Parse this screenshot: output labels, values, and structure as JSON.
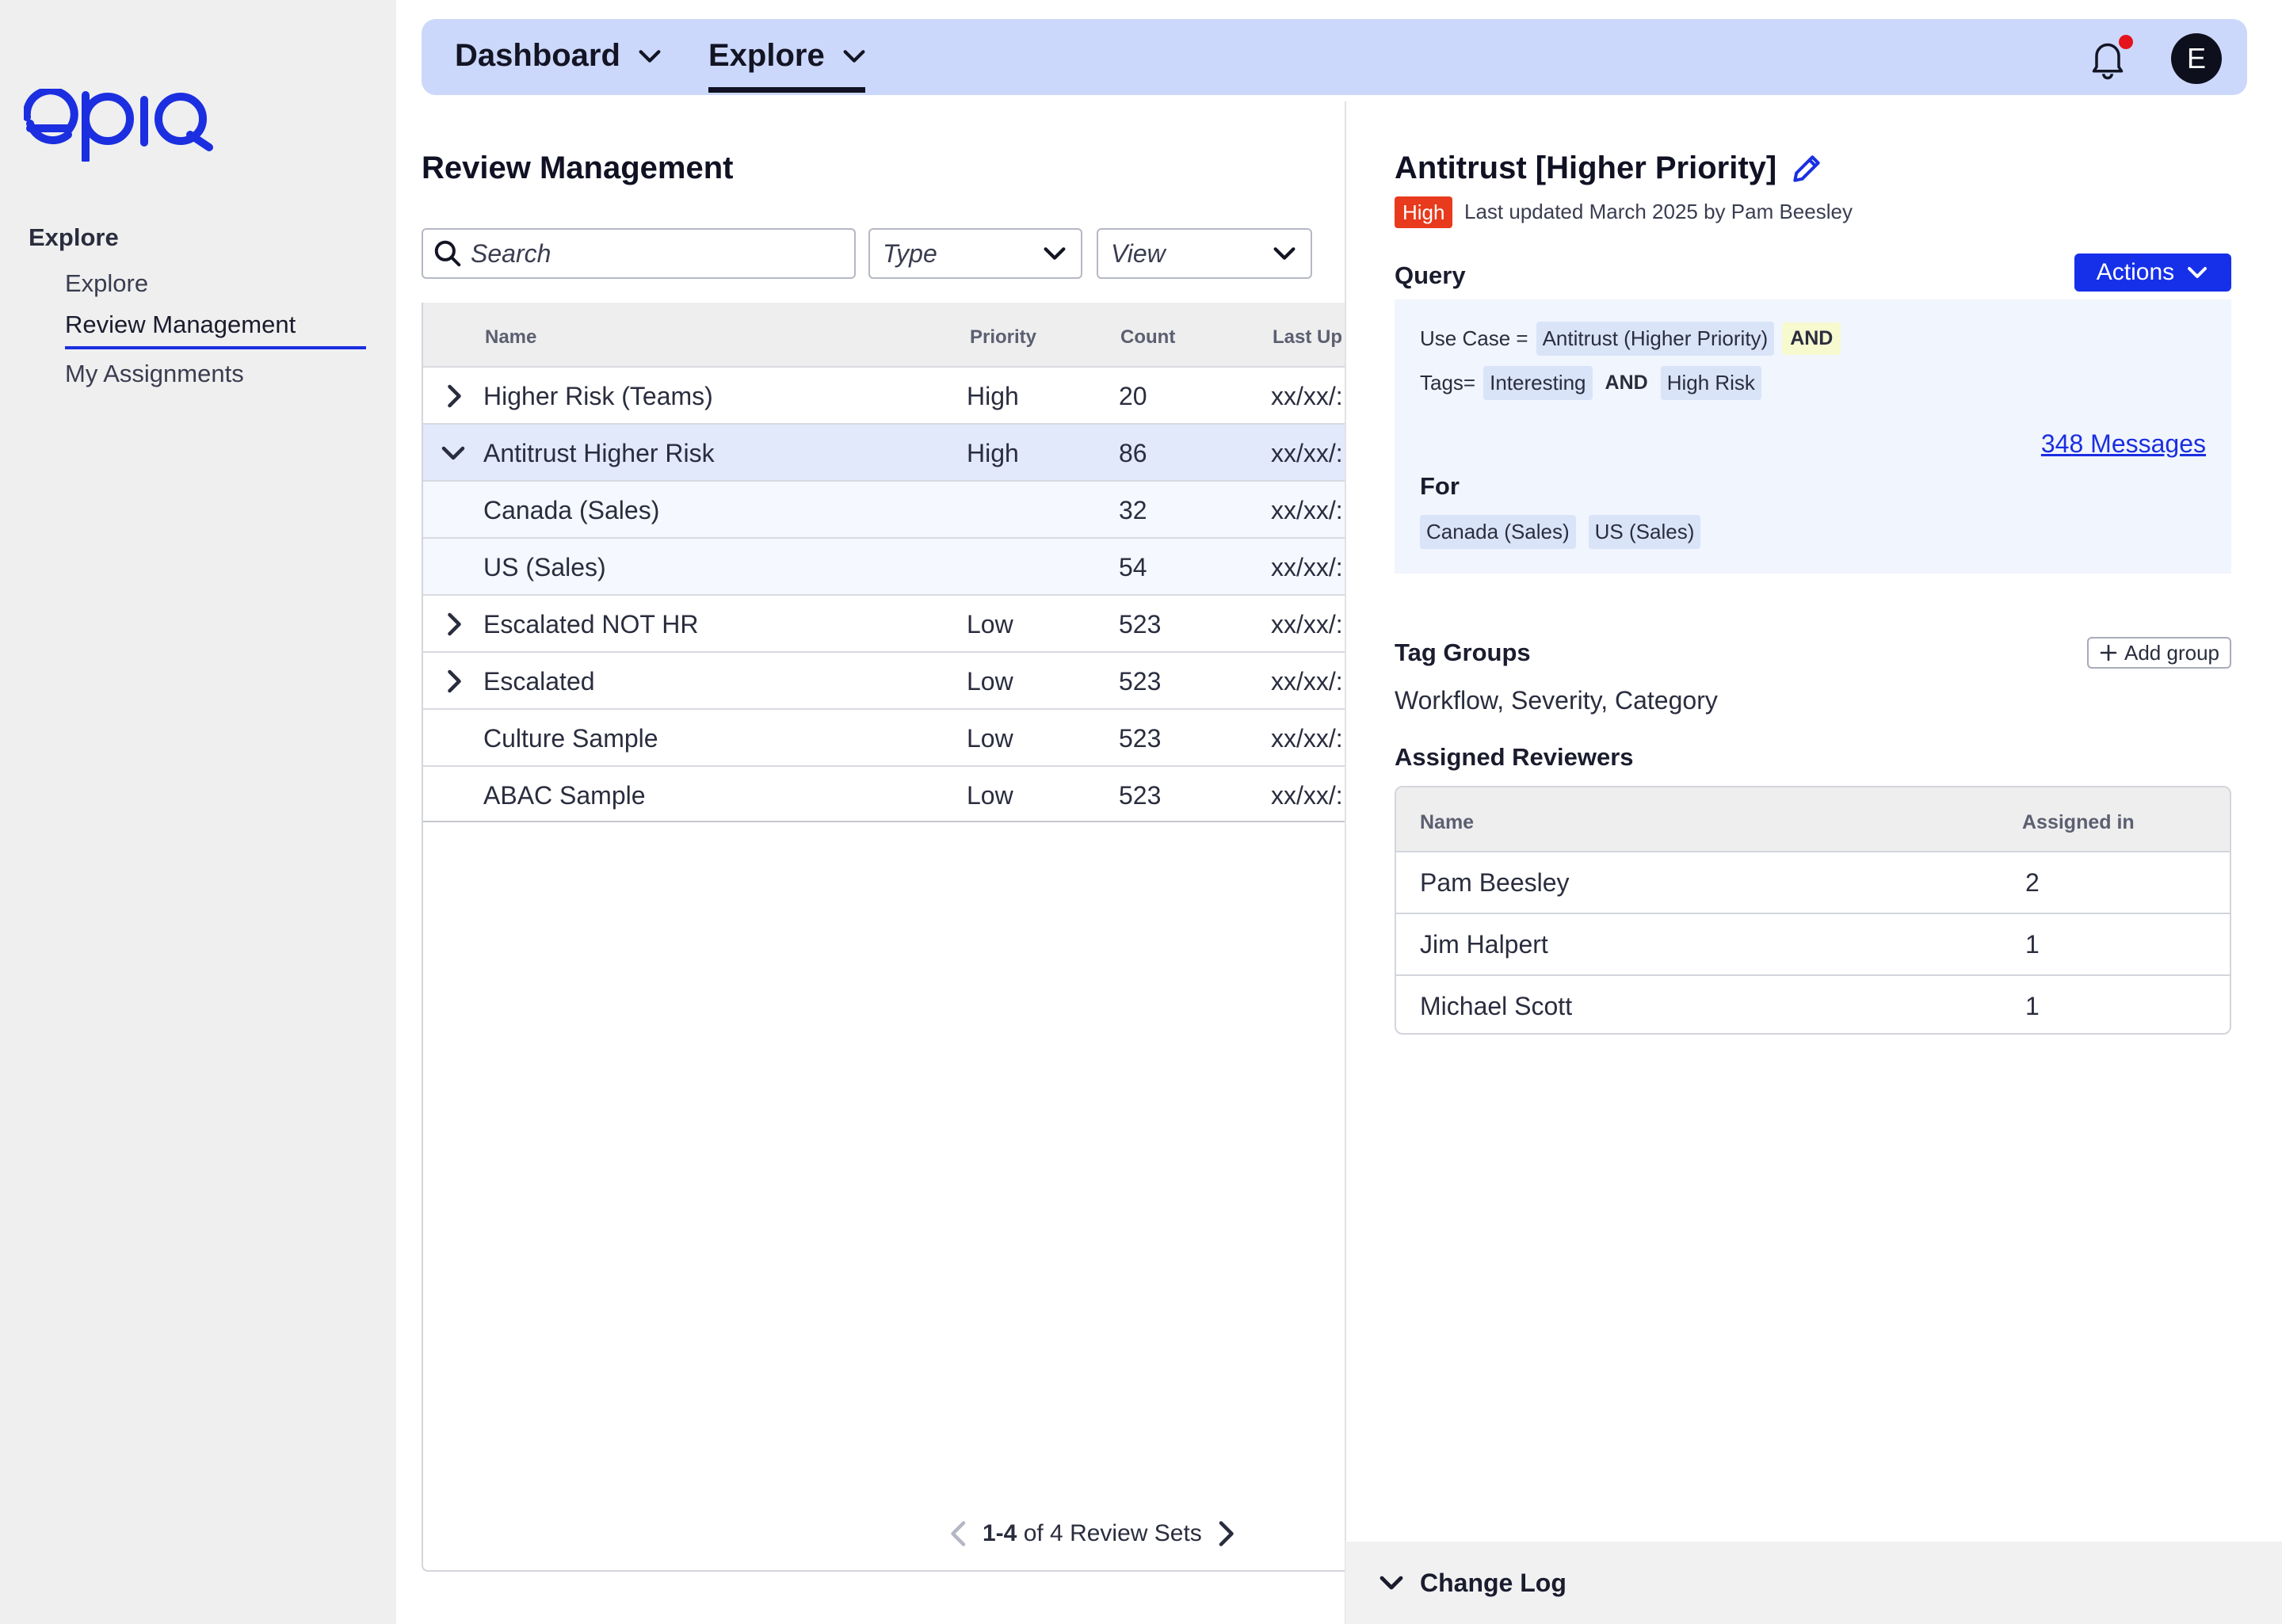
{
  "brand": {
    "logo_text": "epiq",
    "accent": "#1b2fe0"
  },
  "sidebar": {
    "section": "Explore",
    "items": [
      {
        "label": "Explore"
      },
      {
        "label": "Review Management"
      },
      {
        "label": "My Assignments"
      }
    ],
    "active_index": 1
  },
  "topbar": {
    "tabs": [
      {
        "label": "Dashboard"
      },
      {
        "label": "Explore"
      }
    ],
    "active_tab": "Explore",
    "notifications_icon": "bell-icon",
    "has_unread": true,
    "avatar_initial": "E"
  },
  "review": {
    "title": "Review Management",
    "search_placeholder": "Search",
    "filters": {
      "type": "Type",
      "view": "View"
    },
    "columns": [
      "Name",
      "Priority",
      "Count",
      "Last Up"
    ],
    "rows": [
      {
        "name": "Higher Risk (Teams)",
        "priority": "High",
        "count": "20",
        "last": "xx/xx/:",
        "expander": "collapsed"
      },
      {
        "name": "Antitrust Higher Risk",
        "priority": "High",
        "count": "86",
        "last": "xx/xx/:",
        "expander": "expanded",
        "selected": true
      },
      {
        "name": "Canada (Sales)",
        "priority": "",
        "count": "32",
        "last": "xx/xx/:",
        "child": true
      },
      {
        "name": "US (Sales)",
        "priority": "",
        "count": "54",
        "last": "xx/xx/:",
        "child": true
      },
      {
        "name": "Escalated NOT HR",
        "priority": "Low",
        "count": "523",
        "last": "xx/xx/:",
        "expander": "collapsed"
      },
      {
        "name": "Escalated",
        "priority": "Low",
        "count": "523",
        "last": "xx/xx/:",
        "expander": "collapsed"
      },
      {
        "name": "Culture Sample",
        "priority": "Low",
        "count": "523",
        "last": "xx/xx/:"
      },
      {
        "name": "ABAC Sample",
        "priority": "Low",
        "count": "523",
        "last": "xx/xx/:"
      }
    ],
    "pager": {
      "range": "1-4",
      "rest": "of 4 Review Sets"
    }
  },
  "detail": {
    "title": "Antitrust [Higher Priority]",
    "priority_badge": "High",
    "updated": "Last updated March 2025 by Pam Beesley",
    "query_heading": "Query",
    "actions_label": "Actions",
    "query": {
      "line1_label": "Use Case =",
      "line1_value": "Antitrust (Higher Priority)",
      "line1_op": "AND",
      "line2_label": "Tags=",
      "line2_value1": "Interesting",
      "line2_op": "AND",
      "line2_value2": "High Risk",
      "messages_link": "348 Messages",
      "for_heading": "For",
      "for_items": [
        "Canada (Sales)",
        "US (Sales)"
      ]
    },
    "tag_groups_heading": "Tag Groups",
    "add_group_label": "Add group",
    "tag_groups_value": "Workflow, Severity, Category",
    "reviewers_heading": "Assigned Reviewers",
    "reviewer_columns": [
      "Name",
      "Assigned in"
    ],
    "reviewers": [
      {
        "name": "Pam Beesley",
        "assigned": "2"
      },
      {
        "name": "Jim Halpert",
        "assigned": "1"
      },
      {
        "name": "Michael Scott",
        "assigned": "1"
      }
    ],
    "change_log_label": "Change Log"
  },
  "colors": {
    "high_badge": "#e83a1c",
    "actions_button": "#1630ea",
    "topbar": "#ccd8fb",
    "selected_row": "#e1e9fb"
  }
}
